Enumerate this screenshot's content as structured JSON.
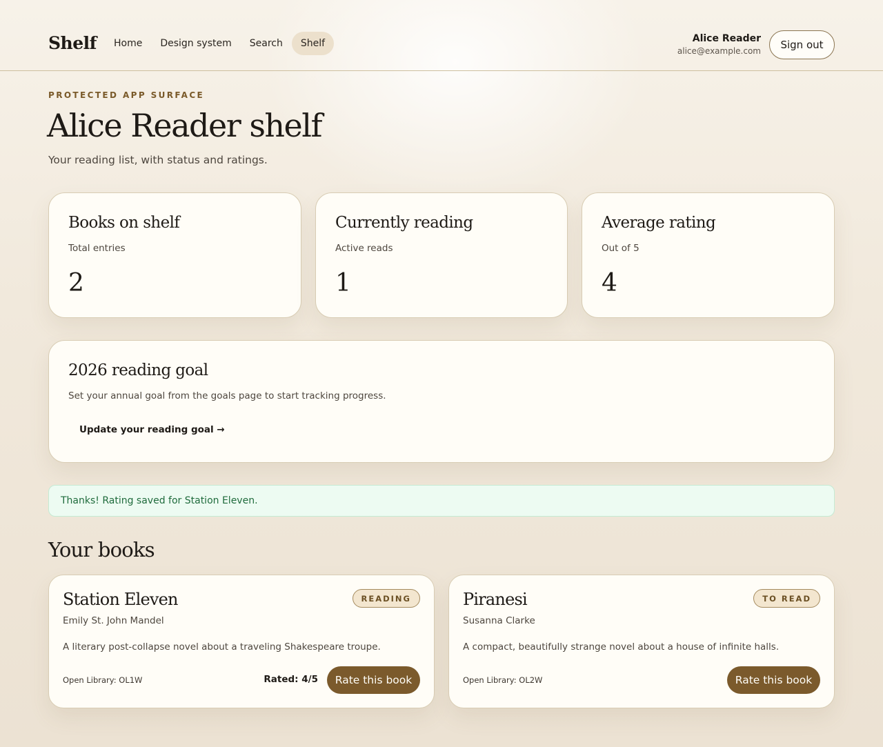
{
  "header": {
    "brand": "Shelf",
    "nav": [
      {
        "label": "Home"
      },
      {
        "label": "Design system"
      },
      {
        "label": "Search"
      },
      {
        "label": "Shelf",
        "active": true
      }
    ],
    "user_name": "Alice Reader",
    "user_email": "alice@example.com",
    "signout_label": "Sign out"
  },
  "page": {
    "eyebrow": "PROTECTED APP SURFACE",
    "title": "Alice Reader shelf",
    "subtitle": "Your reading list, with status and ratings."
  },
  "stats": [
    {
      "title": "Books on shelf",
      "sub": "Total entries",
      "value": "2"
    },
    {
      "title": "Currently reading",
      "sub": "Active reads",
      "value": "1"
    },
    {
      "title": "Average rating",
      "sub": "Out of 5",
      "value": "4"
    }
  ],
  "goal": {
    "title": "2026 reading goal",
    "description": "Set your annual goal from the goals page to start tracking progress.",
    "link": "Update your reading goal →"
  },
  "notice": "Thanks! Rating saved for Station Eleven.",
  "books_heading": "Your books",
  "books": [
    {
      "title": "Station Eleven",
      "author": "Emily St. John Mandel",
      "status": "READING",
      "description": "A literary post-collapse novel about a traveling Shakespeare troupe.",
      "open_library": "Open Library: OL1W",
      "rated": "Rated: 4/5",
      "rate_label": "Rate this book"
    },
    {
      "title": "Piranesi",
      "author": "Susanna Clarke",
      "status": "TO READ",
      "description": "A compact, beautifully strange novel about a house of infinite halls.",
      "open_library": "Open Library: OL2W",
      "rate_label": "Rate this book"
    }
  ],
  "colors": {
    "accent": "#7b5a2c",
    "badge_bg": "#f3e6cf",
    "notice_bg": "#edfbf2",
    "notice_text": "#1f6b3c"
  }
}
